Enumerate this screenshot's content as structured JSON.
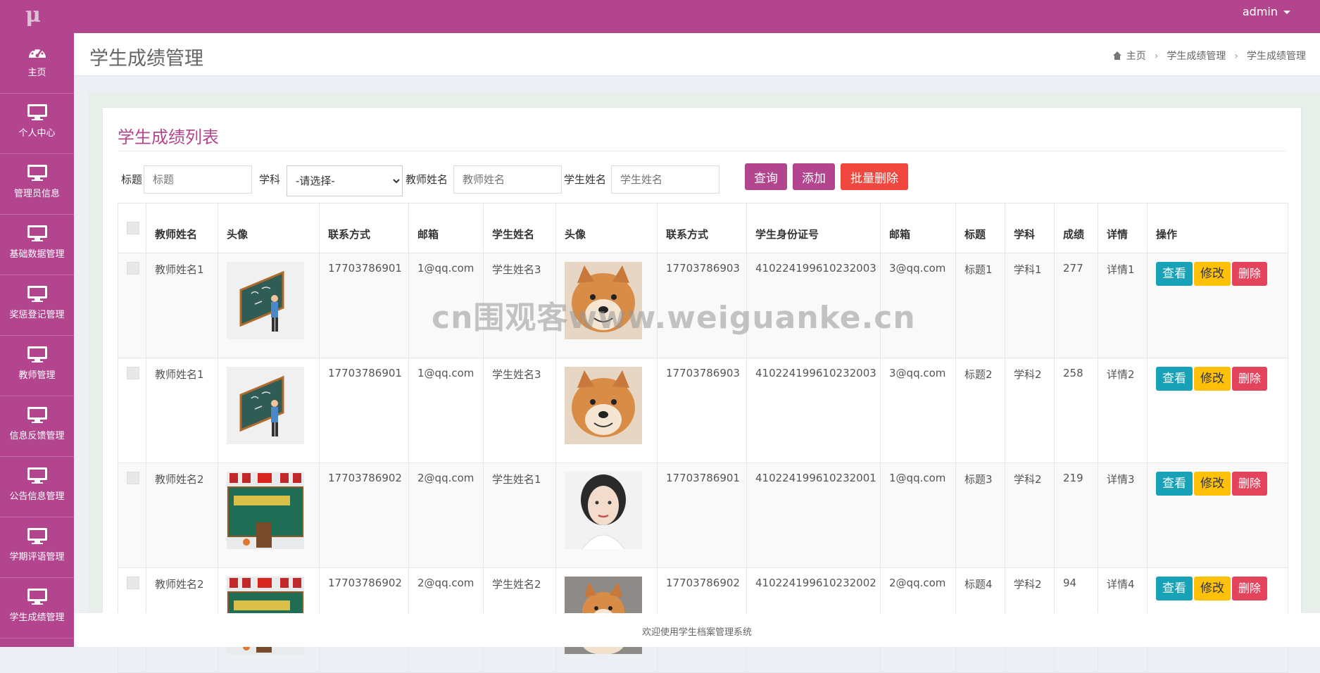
{
  "topbar": {
    "logo": "μ",
    "user": "admin"
  },
  "sidebar": {
    "items": [
      {
        "label": "主页",
        "icon": "dashboard-icon"
      },
      {
        "label": "个人中心",
        "icon": "monitor-icon"
      },
      {
        "label": "管理员信息",
        "icon": "monitor-icon"
      },
      {
        "label": "基础数据管理",
        "icon": "monitor-icon"
      },
      {
        "label": "奖惩登记管理",
        "icon": "monitor-icon"
      },
      {
        "label": "教师管理",
        "icon": "monitor-icon"
      },
      {
        "label": "信息反馈管理",
        "icon": "monitor-icon"
      },
      {
        "label": "公告信息管理",
        "icon": "monitor-icon"
      },
      {
        "label": "学期评语管理",
        "icon": "monitor-icon"
      },
      {
        "label": "学生成绩管理",
        "icon": "monitor-icon"
      }
    ]
  },
  "page": {
    "title": "学生成绩管理",
    "breadcrumb": [
      "主页",
      "学生成绩管理",
      "学生成绩管理"
    ]
  },
  "card": {
    "title": "学生成绩列表"
  },
  "filters": {
    "title_label": "标题",
    "title_placeholder": "标题",
    "subject_label": "学科",
    "subject_selected": "-请选择-",
    "teacher_label": "教师姓名",
    "teacher_placeholder": "教师姓名",
    "student_label": "学生姓名",
    "student_placeholder": "学生姓名",
    "query_btn": "查询",
    "add_btn": "添加",
    "batch_delete_btn": "批量删除"
  },
  "table": {
    "headers": [
      "教师姓名",
      "头像",
      "联系方式",
      "邮箱",
      "学生姓名",
      "头像",
      "联系方式",
      "学生身份证号",
      "邮箱",
      "标题",
      "学科",
      "成绩",
      "详情",
      "操作"
    ],
    "rows": [
      {
        "teacher": "教师姓名1",
        "teacher_phone": "17703786901",
        "teacher_email": "1@qq.com",
        "student": "学生姓名3",
        "student_phone": "17703786903",
        "id_card": "410224199610232003",
        "student_email": "3@qq.com",
        "title": "标题1",
        "subject": "学科1",
        "score": "277",
        "detail": "详情1"
      },
      {
        "teacher": "教师姓名1",
        "teacher_phone": "17703786901",
        "teacher_email": "1@qq.com",
        "student": "学生姓名3",
        "student_phone": "17703786903",
        "id_card": "410224199610232003",
        "student_email": "3@qq.com",
        "title": "标题2",
        "subject": "学科2",
        "score": "258",
        "detail": "详情2"
      },
      {
        "teacher": "教师姓名2",
        "teacher_phone": "17703786902",
        "teacher_email": "2@qq.com",
        "student": "学生姓名1",
        "student_phone": "17703786901",
        "id_card": "410224199610232001",
        "student_email": "1@qq.com",
        "title": "标题3",
        "subject": "学科2",
        "score": "219",
        "detail": "详情3"
      },
      {
        "teacher": "教师姓名2",
        "teacher_phone": "17703786902",
        "teacher_email": "2@qq.com",
        "student": "学生姓名2",
        "student_phone": "17703786902",
        "id_card": "410224199610232002",
        "student_email": "2@qq.com",
        "title": "标题4",
        "subject": "学科2",
        "score": "94",
        "detail": "详情4"
      }
    ],
    "actions": {
      "view": "查看",
      "edit": "修改",
      "delete": "删除"
    }
  },
  "watermark": "cn围观客www.weiguanke.cn",
  "footer": "欢迎使用学生档案管理系统",
  "colors": {
    "brand": "#b3458f",
    "danger": "#f0483e",
    "info": "#17a2b8",
    "warning": "#ffc107"
  }
}
